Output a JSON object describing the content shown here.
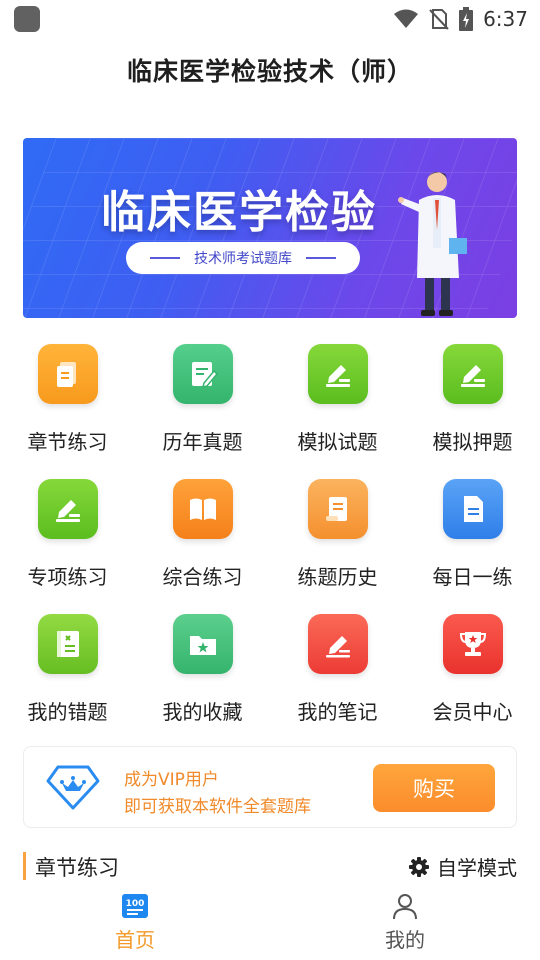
{
  "status_bar": {
    "time": "6:37"
  },
  "header": {
    "title": "临床医学检验技术（师）"
  },
  "banner": {
    "title": "临床医学检验",
    "subtitle": "技术师考试题库"
  },
  "features": [
    {
      "label": "章节练习",
      "icon": "document-icon",
      "color": "#f9a42a"
    },
    {
      "label": "历年真题",
      "icon": "edit-note-icon",
      "color": "#3fbf7a"
    },
    {
      "label": "模拟试题",
      "icon": "pencil-paper-icon",
      "color": "#6cc82a"
    },
    {
      "label": "模拟押题",
      "icon": "pencil-paper-icon",
      "color": "#6cc82a"
    },
    {
      "label": "专项练习",
      "icon": "pencil-paper-icon",
      "color": "#6cc82a"
    },
    {
      "label": "综合练习",
      "icon": "book-icon",
      "color": "#fb8f1f"
    },
    {
      "label": "练题历史",
      "icon": "scroll-icon",
      "color": "#f7a047"
    },
    {
      "label": "每日一练",
      "icon": "file-icon",
      "color": "#3f8ef0"
    },
    {
      "label": "我的错题",
      "icon": "wrong-notebook-icon",
      "color": "#7ccc2e"
    },
    {
      "label": "我的收藏",
      "icon": "star-folder-icon",
      "color": "#45c07c"
    },
    {
      "label": "我的笔记",
      "icon": "pencil-note-icon",
      "color": "#f6463f"
    },
    {
      "label": "会员中心",
      "icon": "trophy-icon",
      "color": "#f3443c"
    }
  ],
  "vip": {
    "line1": "成为VIP用户",
    "line2": "即可获取本软件全套题库",
    "button": "购买",
    "accent": "#f08a2a"
  },
  "section": {
    "title": "章节练习",
    "mode_label": "自学模式"
  },
  "bottom_nav": {
    "items": [
      {
        "label": "首页",
        "icon": "home-100-icon",
        "active": true,
        "color": "#f39a2a"
      },
      {
        "label": "我的",
        "icon": "person-icon",
        "active": false,
        "color": "#555555"
      }
    ]
  }
}
